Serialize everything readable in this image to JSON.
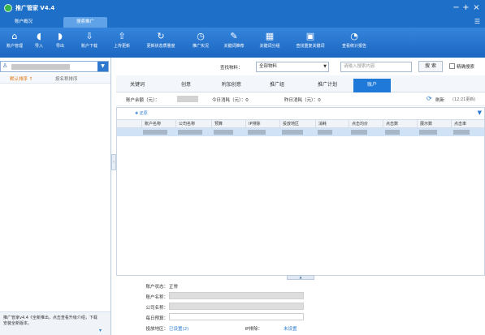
{
  "app": {
    "title": "推广管家 V4.4",
    "window_buttons": {
      "min": "−",
      "max": "+",
      "close": "×"
    }
  },
  "tabs": [
    {
      "label": "账户概况",
      "active": false
    },
    {
      "label": "搜索推广",
      "active": true
    }
  ],
  "toolbar": [
    {
      "icon": "home-icon",
      "glyph": "⌂",
      "label": "账户管理"
    },
    {
      "icon": "import-icon",
      "glyph": "◖",
      "label": "导入"
    },
    {
      "icon": "export-icon",
      "glyph": "◗",
      "label": "导出"
    },
    {
      "icon": "download-icon",
      "glyph": "⇩",
      "label": "账户下载"
    },
    {
      "icon": "upload-icon",
      "glyph": "⇧",
      "label": "上传更新"
    },
    {
      "icon": "refresh-status-icon",
      "glyph": "↻",
      "label": "更新状态质量度"
    },
    {
      "icon": "clock-icon",
      "glyph": "◷",
      "label": "推广实况"
    },
    {
      "icon": "keyword-recommend-icon",
      "glyph": "✎",
      "label": "关键词推荐"
    },
    {
      "icon": "keyword-group-icon",
      "glyph": "▦",
      "label": "关键词分组"
    },
    {
      "icon": "duplicate-check-icon",
      "glyph": "▣",
      "label": "查找重复关键词"
    },
    {
      "icon": "report-icon",
      "glyph": "◔",
      "label": "查看统计报告"
    }
  ],
  "left": {
    "sort_default": "默认排序 ↑",
    "sort_name": "按名称排序",
    "footer_text": "推广管家v4.4《全新推出，点击查看升级介绍，下载安装全新版本。",
    "footer_arrow": "▾"
  },
  "filter": {
    "find_label": "查找物料：",
    "find_value": "全部物料",
    "keyword_placeholder": "请输入搜索内容",
    "search_button": "搜 索",
    "exact_label": "精确搜索"
  },
  "subtabs": [
    {
      "label": "关键词",
      "active": false
    },
    {
      "label": "创意",
      "active": false
    },
    {
      "label": "附加创意",
      "active": false
    },
    {
      "label": "推广组",
      "active": false
    },
    {
      "label": "推广计划",
      "active": false
    },
    {
      "label": "账户",
      "active": true
    }
  ],
  "stats": {
    "balance_label": "账户余额（元）：",
    "today_label": "今日消耗（元）：0",
    "yesterday_label": "昨日消耗（元）：0",
    "refresh_label": "刷新",
    "refresh_time": "(12:21更新)"
  },
  "grid": {
    "add_label": "✚ 还原",
    "columns": [
      "账户名称",
      "公司名称",
      "预算",
      "IP排除",
      "投放地区",
      "消耗",
      "点击均价",
      "点击数",
      "展示数",
      "点击率"
    ]
  },
  "details": {
    "status_label": "账户状态：",
    "status_value": "正常",
    "account_label": "账户名称：",
    "company_label": "公司名称：",
    "budget_label": "每日预算：",
    "region_label": "投放地区：",
    "region_value": "已设置(2)",
    "ip_label": "IP排除：",
    "ip_value": "未设置"
  },
  "colors": {
    "titlebar": "#1e6fc8",
    "toolbar": "#2a78d2",
    "active_subtab": "#1e79d8",
    "sort_highlight": "#e06c00"
  }
}
